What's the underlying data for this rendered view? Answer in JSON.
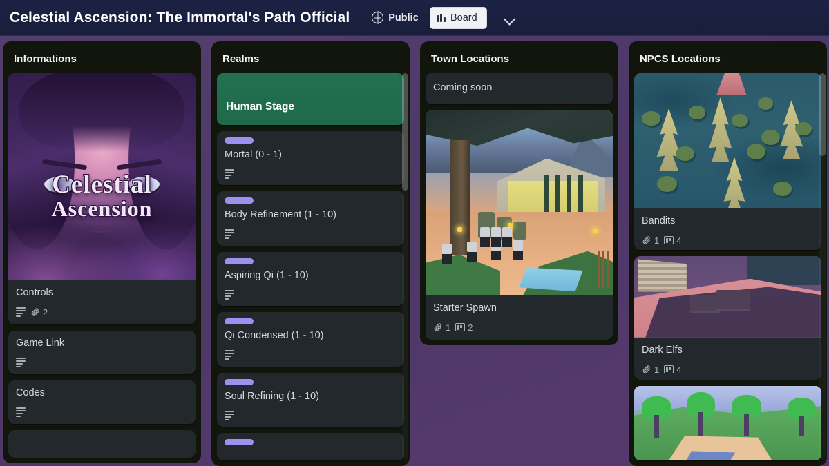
{
  "header": {
    "title": "Celestial Ascension: The Immortal's Path Official",
    "visibility": "Public",
    "visibility_icon": "globe-icon",
    "view_label": "Board",
    "view_icon": "board-columns-icon",
    "chevron_icon": "chevron-down-icon"
  },
  "theme": {
    "board_bg": "#4e3a68",
    "header_bg": "#1b2040",
    "list_bg": "#12150b",
    "card_bg": "#23282c",
    "cover_green": "#216e4e",
    "label_purple": "#9f8fef",
    "text_primary": "#d5d9dd",
    "text_muted": "#a6aeb6"
  },
  "lists": [
    {
      "title": "Informations",
      "cards": [
        {
          "title": "Controls",
          "cover": "celestial-key-art",
          "logo_line1": "Celestial",
          "logo_line2": "Ascension",
          "badges": [
            {
              "icon": "description-icon",
              "value": ""
            },
            {
              "icon": "attachment-icon",
              "value": "2"
            }
          ]
        },
        {
          "title": "Game Link",
          "badges": [
            {
              "icon": "description-icon",
              "value": ""
            }
          ]
        },
        {
          "title": "Codes",
          "badges": [
            {
              "icon": "description-icon",
              "value": ""
            }
          ]
        },
        {
          "title": "",
          "badges": []
        }
      ]
    },
    {
      "title": "Realms",
      "cards": [
        {
          "title": "Human Stage",
          "cover": "green",
          "badges": []
        },
        {
          "title": "Mortal (0 - 1)",
          "label": "purple",
          "badges": [
            {
              "icon": "description-icon",
              "value": ""
            }
          ]
        },
        {
          "title": "Body Refinement (1 - 10)",
          "label": "purple",
          "badges": [
            {
              "icon": "description-icon",
              "value": ""
            }
          ]
        },
        {
          "title": "Aspiring Qi (1 - 10)",
          "label": "purple",
          "badges": [
            {
              "icon": "description-icon",
              "value": ""
            }
          ]
        },
        {
          "title": "Qi Condensed (1 - 10)",
          "label": "purple",
          "badges": [
            {
              "icon": "description-icon",
              "value": ""
            }
          ]
        },
        {
          "title": "Soul Refining (1 - 10)",
          "label": "purple",
          "badges": [
            {
              "icon": "description-icon",
              "value": ""
            }
          ]
        },
        {
          "title": "",
          "label": "purple",
          "badges": []
        }
      ]
    },
    {
      "title": "Town Locations",
      "cards": [
        {
          "title": "Coming soon",
          "badges": []
        },
        {
          "title": "Starter Spawn",
          "cover": "starter-spawn-screenshot",
          "badges": [
            {
              "icon": "attachment-icon",
              "value": "1"
            },
            {
              "icon": "board-icon",
              "value": "2"
            }
          ]
        }
      ]
    },
    {
      "title": "NPCS Locations",
      "cards": [
        {
          "title": "Bandits",
          "cover": "bandits-forest-screenshot",
          "badges": [
            {
              "icon": "attachment-icon",
              "value": "1"
            },
            {
              "icon": "board-icon",
              "value": "4"
            }
          ]
        },
        {
          "title": "Dark Elfs",
          "cover": "dark-elfs-screenshot",
          "badges": [
            {
              "icon": "attachment-icon",
              "value": "1"
            },
            {
              "icon": "board-icon",
              "value": "4"
            }
          ]
        },
        {
          "title": "",
          "cover": "green-forest-screenshot",
          "badges": []
        }
      ]
    }
  ]
}
